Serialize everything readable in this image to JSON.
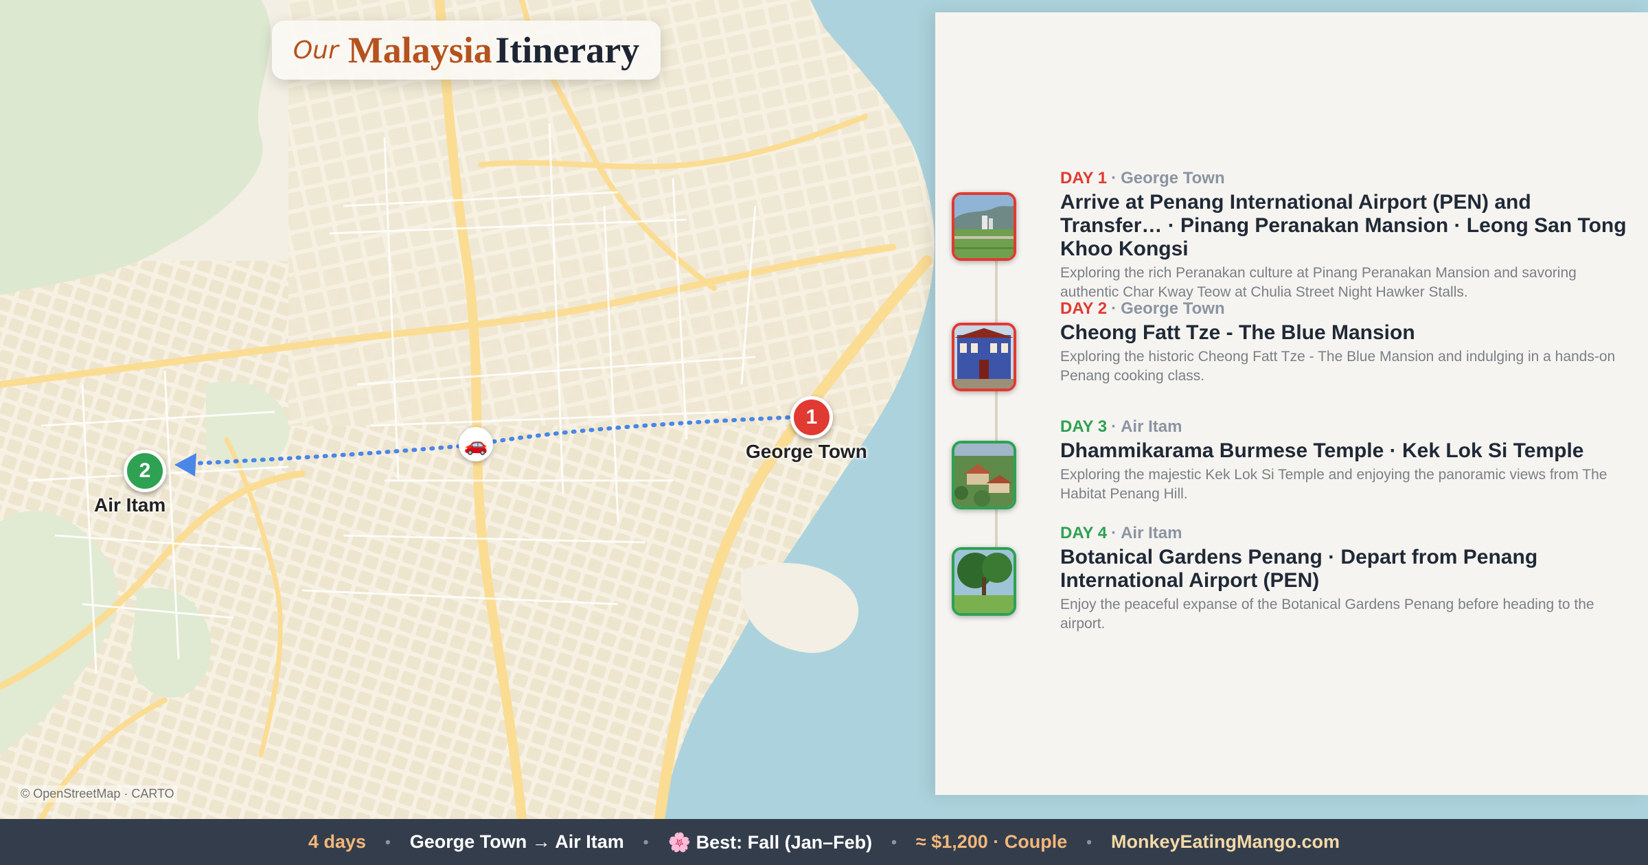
{
  "title": {
    "prefix": "Our",
    "country": "Malaysia",
    "word": "Itinerary"
  },
  "map": {
    "attribution": "© OpenStreetMap · CARTO",
    "markers": [
      {
        "number": "1",
        "label": "George Town",
        "color": "#e03a32"
      },
      {
        "number": "2",
        "label": "Air Itam",
        "color": "#2ea152"
      }
    ],
    "route_icon": "car-icon",
    "route_glyph": "🚗",
    "route_color": "#4a86e8"
  },
  "days": [
    {
      "day": "DAY 1",
      "sep": "·",
      "place": "George Town",
      "color": "#e03a32",
      "title": "Arrive at Penang International Airport (PEN) and Transfer… · Pinang Peranakan Mansion · Leong San Tong Khoo Kongsi",
      "desc": "Exploring the rich Peranakan culture at Pinang Peranakan Mansion and savoring authentic Char Kway Teow at Chulia Street Night Hawker Stalls."
    },
    {
      "day": "DAY 2",
      "sep": "·",
      "place": "George Town",
      "color": "#e03a32",
      "title": "Cheong Fatt Tze - The Blue Mansion",
      "desc": "Exploring the historic Cheong Fatt Tze - The Blue Mansion and indulging in a hands-on Penang cooking class."
    },
    {
      "day": "DAY 3",
      "sep": "·",
      "place": "Air Itam",
      "color": "#2ea152",
      "title": "Dhammikarama Burmese Temple · Kek Lok Si Temple",
      "desc": "Exploring the majestic Kek Lok Si Temple and enjoying the panoramic views from The Habitat Penang Hill."
    },
    {
      "day": "DAY 4",
      "sep": "·",
      "place": "Air Itam",
      "color": "#2ea152",
      "title": "Botanical Gardens Penang · Depart from Penang International Airport (PEN)",
      "desc": "Enjoy the peaceful expanse of the Botanical Gardens Penang before heading to the airport."
    }
  ],
  "footer": {
    "duration": "4 days",
    "route": "George Town → Air Itam",
    "best": "🌸 Best: Fall (Jan–Feb)",
    "cost": "≈ $1,200 · Couple",
    "site": "MonkeyEatingMango.com",
    "separator": "•"
  }
}
